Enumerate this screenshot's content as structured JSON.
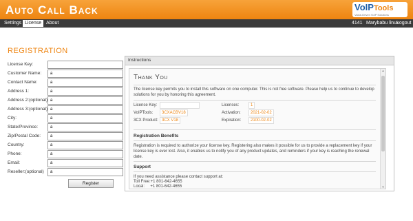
{
  "app": {
    "title": "Auto Call Back"
  },
  "logo": {
    "brand_voip": "VoIP",
    "brand_tools": "Tools",
    "tagline": "Value-Driven VoIP Solutions"
  },
  "nav": {
    "items": [
      {
        "label": "Settings",
        "active": false
      },
      {
        "label": "License",
        "active": true
      },
      {
        "label": "About",
        "active": false
      }
    ],
    "extension": "4141",
    "user": "Marybabu linux",
    "logout": "Logout"
  },
  "registration": {
    "title": "REGISTRATION",
    "fields": [
      {
        "label": "License Key:",
        "value": ""
      },
      {
        "label": "Customer Name:",
        "value": "a"
      },
      {
        "label": "Contact Name:",
        "value": "a"
      },
      {
        "label": "Address 1:",
        "value": "a"
      },
      {
        "label": "Address 2:(optional)",
        "value": "a"
      },
      {
        "label": "Address 3:(optional)",
        "value": "a"
      },
      {
        "label": "City:",
        "value": "a"
      },
      {
        "label": "State/Province:",
        "value": "a"
      },
      {
        "label": "Zip/Postal Code:",
        "value": "a"
      },
      {
        "label": "Country:",
        "value": "a"
      },
      {
        "label": "Phone:",
        "value": "a"
      },
      {
        "label": "Email:",
        "value": "a"
      },
      {
        "label": "Reseller:(optional)",
        "value": "a"
      }
    ],
    "register_label": "Register"
  },
  "instructions": {
    "header": "Instructions",
    "thank_you": "Thank You",
    "intro": "The license key permits you to install this software on one computer. This is not free software. Please help us to continue to develop solutions for you by honoring this agreement.",
    "license": {
      "key_label": "License Key:",
      "key_value": "",
      "licenses_label": "Licenses:",
      "licenses_value": "1",
      "voiptools_label": "VoIPTools:",
      "voiptools_value": "3CXACBV18",
      "activation_label": "Activation:",
      "activation_value": "2021-02-02",
      "product_label": "3CX Product:",
      "product_value": "3CX V18",
      "expiration_label": "Expiration:",
      "expiration_value": "2100-02-02"
    },
    "benefits_title": "Registration Benefits",
    "benefits_text": "Registration is required to authorize your license key. Registering also makes it possible for us to provide a replacement key if your license key is ever lost. Also, it enables us to notify you of any product updates, and reminders if your key is reaching the renewal date.",
    "support_title": "Support",
    "support_text": "If you need assistance please contact support at:",
    "toll_free": "Toll Free:+1 801-642-4655",
    "local": "Local:     +1 801-642-4655"
  },
  "colors": {
    "accent": "#ee8410",
    "navbar": "#3a3a3a",
    "brand_blue": "#1f5fa8"
  }
}
